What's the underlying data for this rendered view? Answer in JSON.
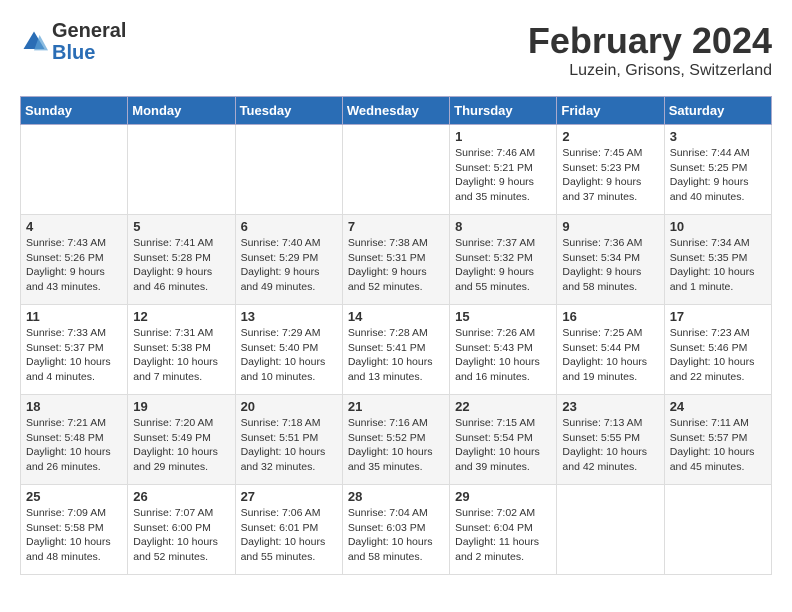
{
  "header": {
    "logo_general": "General",
    "logo_blue": "Blue",
    "month_year": "February 2024",
    "location": "Luzein, Grisons, Switzerland"
  },
  "days_of_week": [
    "Sunday",
    "Monday",
    "Tuesday",
    "Wednesday",
    "Thursday",
    "Friday",
    "Saturday"
  ],
  "weeks": [
    {
      "days": [
        {
          "number": "",
          "info": ""
        },
        {
          "number": "",
          "info": ""
        },
        {
          "number": "",
          "info": ""
        },
        {
          "number": "",
          "info": ""
        },
        {
          "number": "1",
          "info": "Sunrise: 7:46 AM\nSunset: 5:21 PM\nDaylight: 9 hours\nand 35 minutes."
        },
        {
          "number": "2",
          "info": "Sunrise: 7:45 AM\nSunset: 5:23 PM\nDaylight: 9 hours\nand 37 minutes."
        },
        {
          "number": "3",
          "info": "Sunrise: 7:44 AM\nSunset: 5:25 PM\nDaylight: 9 hours\nand 40 minutes."
        }
      ]
    },
    {
      "days": [
        {
          "number": "4",
          "info": "Sunrise: 7:43 AM\nSunset: 5:26 PM\nDaylight: 9 hours\nand 43 minutes."
        },
        {
          "number": "5",
          "info": "Sunrise: 7:41 AM\nSunset: 5:28 PM\nDaylight: 9 hours\nand 46 minutes."
        },
        {
          "number": "6",
          "info": "Sunrise: 7:40 AM\nSunset: 5:29 PM\nDaylight: 9 hours\nand 49 minutes."
        },
        {
          "number": "7",
          "info": "Sunrise: 7:38 AM\nSunset: 5:31 PM\nDaylight: 9 hours\nand 52 minutes."
        },
        {
          "number": "8",
          "info": "Sunrise: 7:37 AM\nSunset: 5:32 PM\nDaylight: 9 hours\nand 55 minutes."
        },
        {
          "number": "9",
          "info": "Sunrise: 7:36 AM\nSunset: 5:34 PM\nDaylight: 9 hours\nand 58 minutes."
        },
        {
          "number": "10",
          "info": "Sunrise: 7:34 AM\nSunset: 5:35 PM\nDaylight: 10 hours\nand 1 minute."
        }
      ]
    },
    {
      "days": [
        {
          "number": "11",
          "info": "Sunrise: 7:33 AM\nSunset: 5:37 PM\nDaylight: 10 hours\nand 4 minutes."
        },
        {
          "number": "12",
          "info": "Sunrise: 7:31 AM\nSunset: 5:38 PM\nDaylight: 10 hours\nand 7 minutes."
        },
        {
          "number": "13",
          "info": "Sunrise: 7:29 AM\nSunset: 5:40 PM\nDaylight: 10 hours\nand 10 minutes."
        },
        {
          "number": "14",
          "info": "Sunrise: 7:28 AM\nSunset: 5:41 PM\nDaylight: 10 hours\nand 13 minutes."
        },
        {
          "number": "15",
          "info": "Sunrise: 7:26 AM\nSunset: 5:43 PM\nDaylight: 10 hours\nand 16 minutes."
        },
        {
          "number": "16",
          "info": "Sunrise: 7:25 AM\nSunset: 5:44 PM\nDaylight: 10 hours\nand 19 minutes."
        },
        {
          "number": "17",
          "info": "Sunrise: 7:23 AM\nSunset: 5:46 PM\nDaylight: 10 hours\nand 22 minutes."
        }
      ]
    },
    {
      "days": [
        {
          "number": "18",
          "info": "Sunrise: 7:21 AM\nSunset: 5:48 PM\nDaylight: 10 hours\nand 26 minutes."
        },
        {
          "number": "19",
          "info": "Sunrise: 7:20 AM\nSunset: 5:49 PM\nDaylight: 10 hours\nand 29 minutes."
        },
        {
          "number": "20",
          "info": "Sunrise: 7:18 AM\nSunset: 5:51 PM\nDaylight: 10 hours\nand 32 minutes."
        },
        {
          "number": "21",
          "info": "Sunrise: 7:16 AM\nSunset: 5:52 PM\nDaylight: 10 hours\nand 35 minutes."
        },
        {
          "number": "22",
          "info": "Sunrise: 7:15 AM\nSunset: 5:54 PM\nDaylight: 10 hours\nand 39 minutes."
        },
        {
          "number": "23",
          "info": "Sunrise: 7:13 AM\nSunset: 5:55 PM\nDaylight: 10 hours\nand 42 minutes."
        },
        {
          "number": "24",
          "info": "Sunrise: 7:11 AM\nSunset: 5:57 PM\nDaylight: 10 hours\nand 45 minutes."
        }
      ]
    },
    {
      "days": [
        {
          "number": "25",
          "info": "Sunrise: 7:09 AM\nSunset: 5:58 PM\nDaylight: 10 hours\nand 48 minutes."
        },
        {
          "number": "26",
          "info": "Sunrise: 7:07 AM\nSunset: 6:00 PM\nDaylight: 10 hours\nand 52 minutes."
        },
        {
          "number": "27",
          "info": "Sunrise: 7:06 AM\nSunset: 6:01 PM\nDaylight: 10 hours\nand 55 minutes."
        },
        {
          "number": "28",
          "info": "Sunrise: 7:04 AM\nSunset: 6:03 PM\nDaylight: 10 hours\nand 58 minutes."
        },
        {
          "number": "29",
          "info": "Sunrise: 7:02 AM\nSunset: 6:04 PM\nDaylight: 11 hours\nand 2 minutes."
        },
        {
          "number": "",
          "info": ""
        },
        {
          "number": "",
          "info": ""
        }
      ]
    }
  ]
}
